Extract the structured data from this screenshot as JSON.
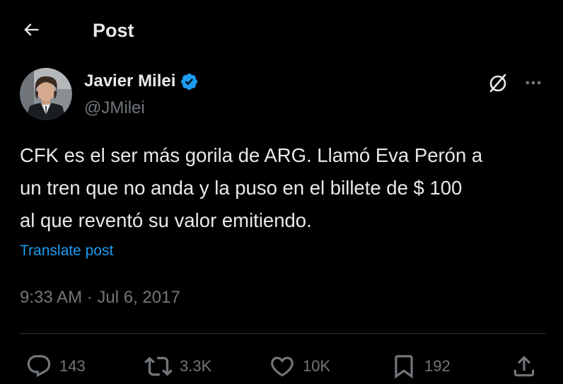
{
  "header": {
    "back_icon": "arrow-left-icon",
    "title": "Post"
  },
  "author": {
    "name": "Javier Milei",
    "handle": "@JMilei",
    "verified_icon": "verified-badge-icon",
    "verified_color": "#1d9bf0"
  },
  "menu": {
    "grok_icon": "grok-icon",
    "more_icon": "more-horizontal-icon"
  },
  "tweet": {
    "text": "CFK es el ser más gorila de ARG. Llamó Eva Perón a\nun tren que no anda y la puso en el billete de $ 100\nal que reventó su valor emitiendo.",
    "translate_label": "Translate post",
    "timestamp": "9:33 AM · Jul 6, 2017"
  },
  "actions": {
    "replies": {
      "icon": "reply-icon",
      "count": "143"
    },
    "reposts": {
      "icon": "repost-icon",
      "count": "3.3K"
    },
    "likes": {
      "icon": "heart-icon",
      "count": "10K"
    },
    "bookmarks": {
      "icon": "bookmark-icon",
      "count": "192"
    },
    "share": {
      "icon": "share-icon"
    }
  },
  "colors": {
    "background": "#000000",
    "text_primary": "#e7e9ea",
    "text_secondary": "#71767b",
    "accent": "#1d9bf0",
    "divider": "#2f3336"
  }
}
